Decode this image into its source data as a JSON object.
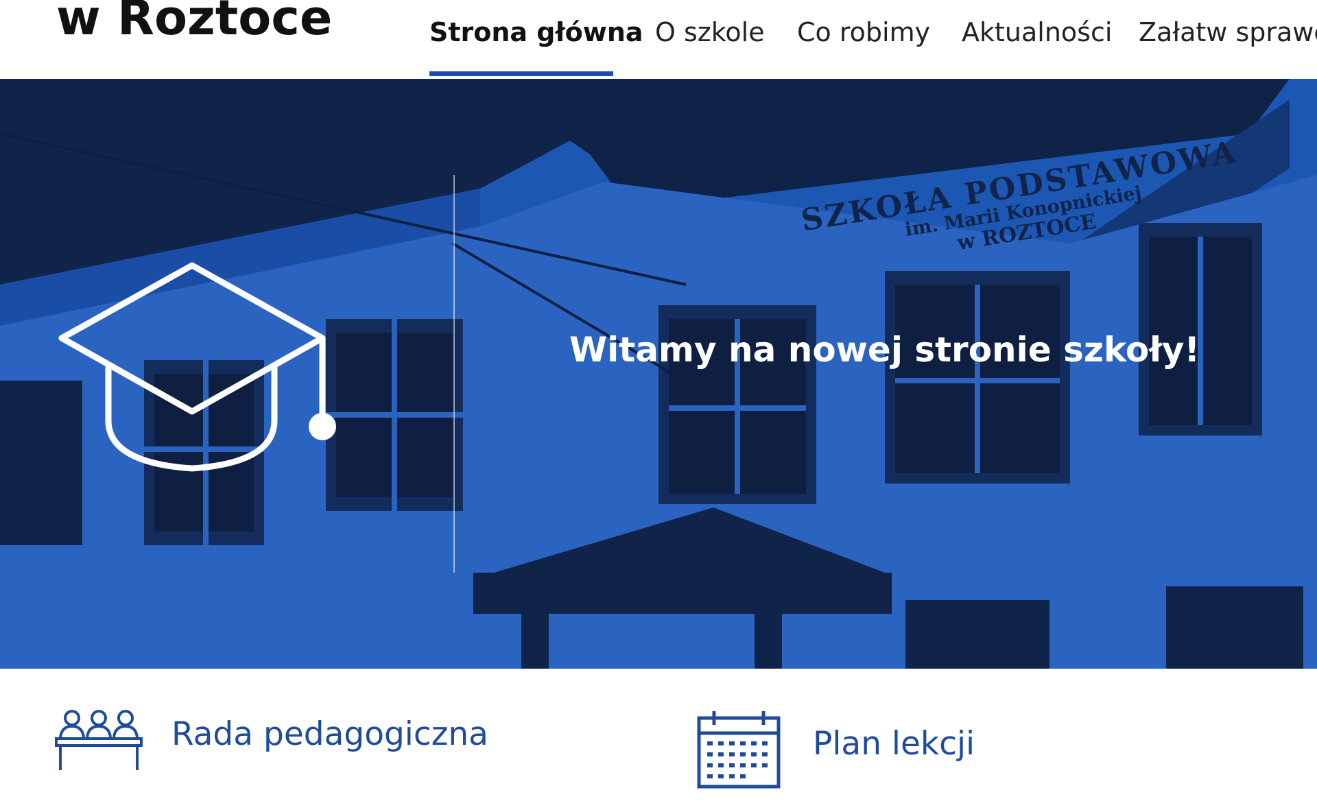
{
  "header": {
    "site_title": "w Roztoce",
    "nav": [
      {
        "label": "Strona główna",
        "active": true
      },
      {
        "label": "O szkole",
        "active": false
      },
      {
        "label": "Co robimy",
        "active": false
      },
      {
        "label": "Aktualności",
        "active": false
      },
      {
        "label": "Załatw sprawę",
        "active": false
      }
    ]
  },
  "hero": {
    "headline": "Witamy na nowej stronie szkoły!",
    "sign_line1": "SZKOŁA PODSTAWOWA",
    "sign_line2": "im. Marii Konopnickiej",
    "sign_line3": "w ROZTOCE",
    "icon": "graduation-cap-icon",
    "overlay_color": "#1c57b3"
  },
  "quick_links": [
    {
      "label": "Rada pedagogiczna",
      "icon": "teachers-group-icon"
    },
    {
      "label": "Plan lekcji",
      "icon": "calendar-icon"
    }
  ],
  "colors": {
    "accent": "#1d4fa8",
    "link_text": "#1e4b9a"
  }
}
